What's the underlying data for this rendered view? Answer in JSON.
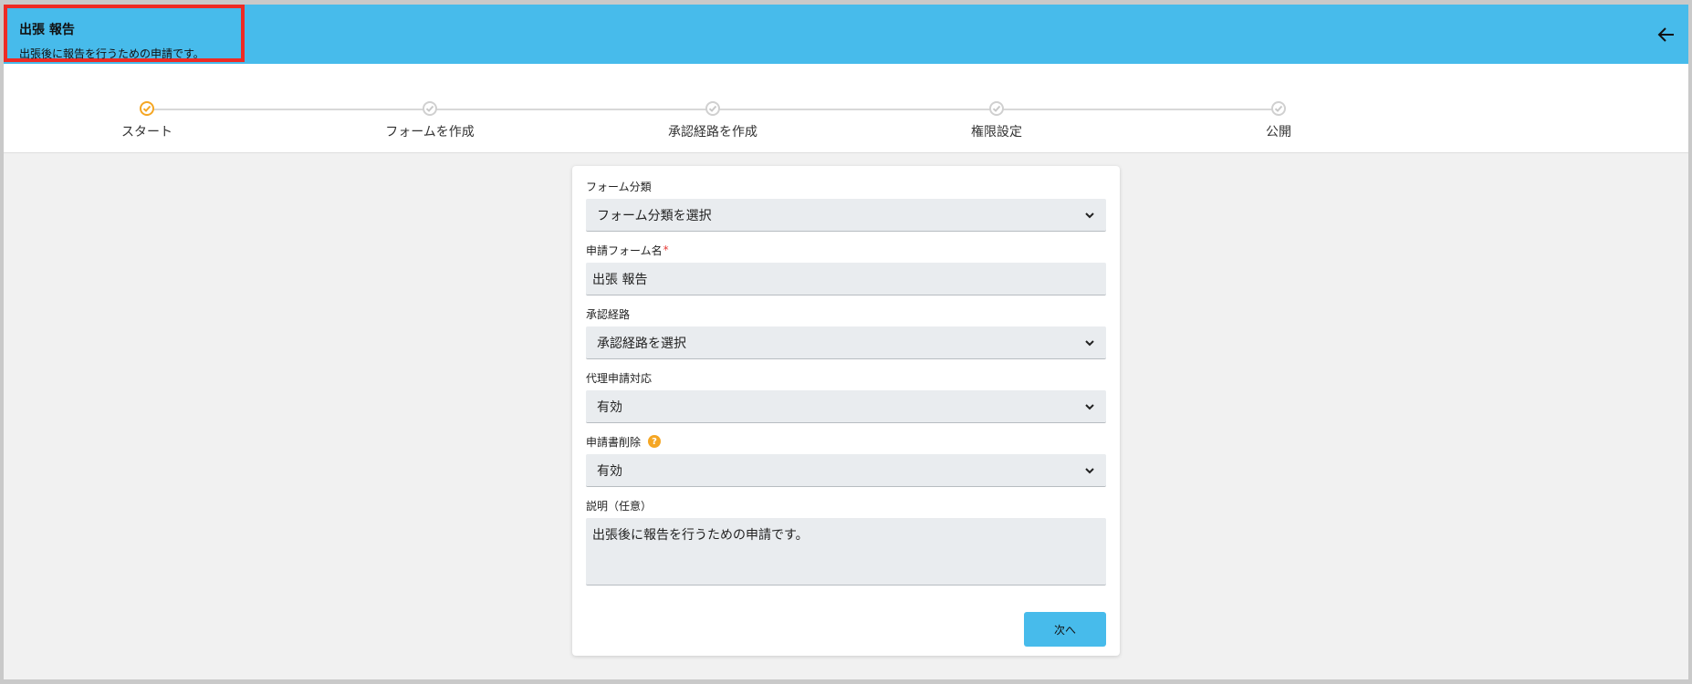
{
  "header": {
    "title": "出張 報告",
    "subtitle": "出張後に報告を行うための申請です。",
    "back_icon": "arrow-left-icon"
  },
  "colors": {
    "header_bg": "#47bbeb",
    "active_step": "#f5a623",
    "inactive_step": "#d8d8d8",
    "highlight_border": "#ee2b24"
  },
  "stepper": {
    "steps": [
      {
        "label": "スタート",
        "status": "active"
      },
      {
        "label": "フォームを作成",
        "status": "pending"
      },
      {
        "label": "承認経路を作成",
        "status": "pending"
      },
      {
        "label": "権限設定",
        "status": "pending"
      },
      {
        "label": "公開",
        "status": "pending"
      }
    ]
  },
  "form": {
    "category": {
      "label": "フォーム分類",
      "value": "フォーム分類を選択"
    },
    "name": {
      "label": "申請フォーム名",
      "required_mark": "*",
      "value": "出張 報告"
    },
    "approval_route": {
      "label": "承認経路",
      "value": "承認経路を選択"
    },
    "proxy": {
      "label": "代理申請対応",
      "value": "有効"
    },
    "delete": {
      "label": "申請書削除",
      "help_icon": "question-circle-icon",
      "value": "有効"
    },
    "description": {
      "label": "説明（任意）",
      "value": "出張後に報告を行うための申請です。"
    },
    "next_label": "次へ"
  }
}
